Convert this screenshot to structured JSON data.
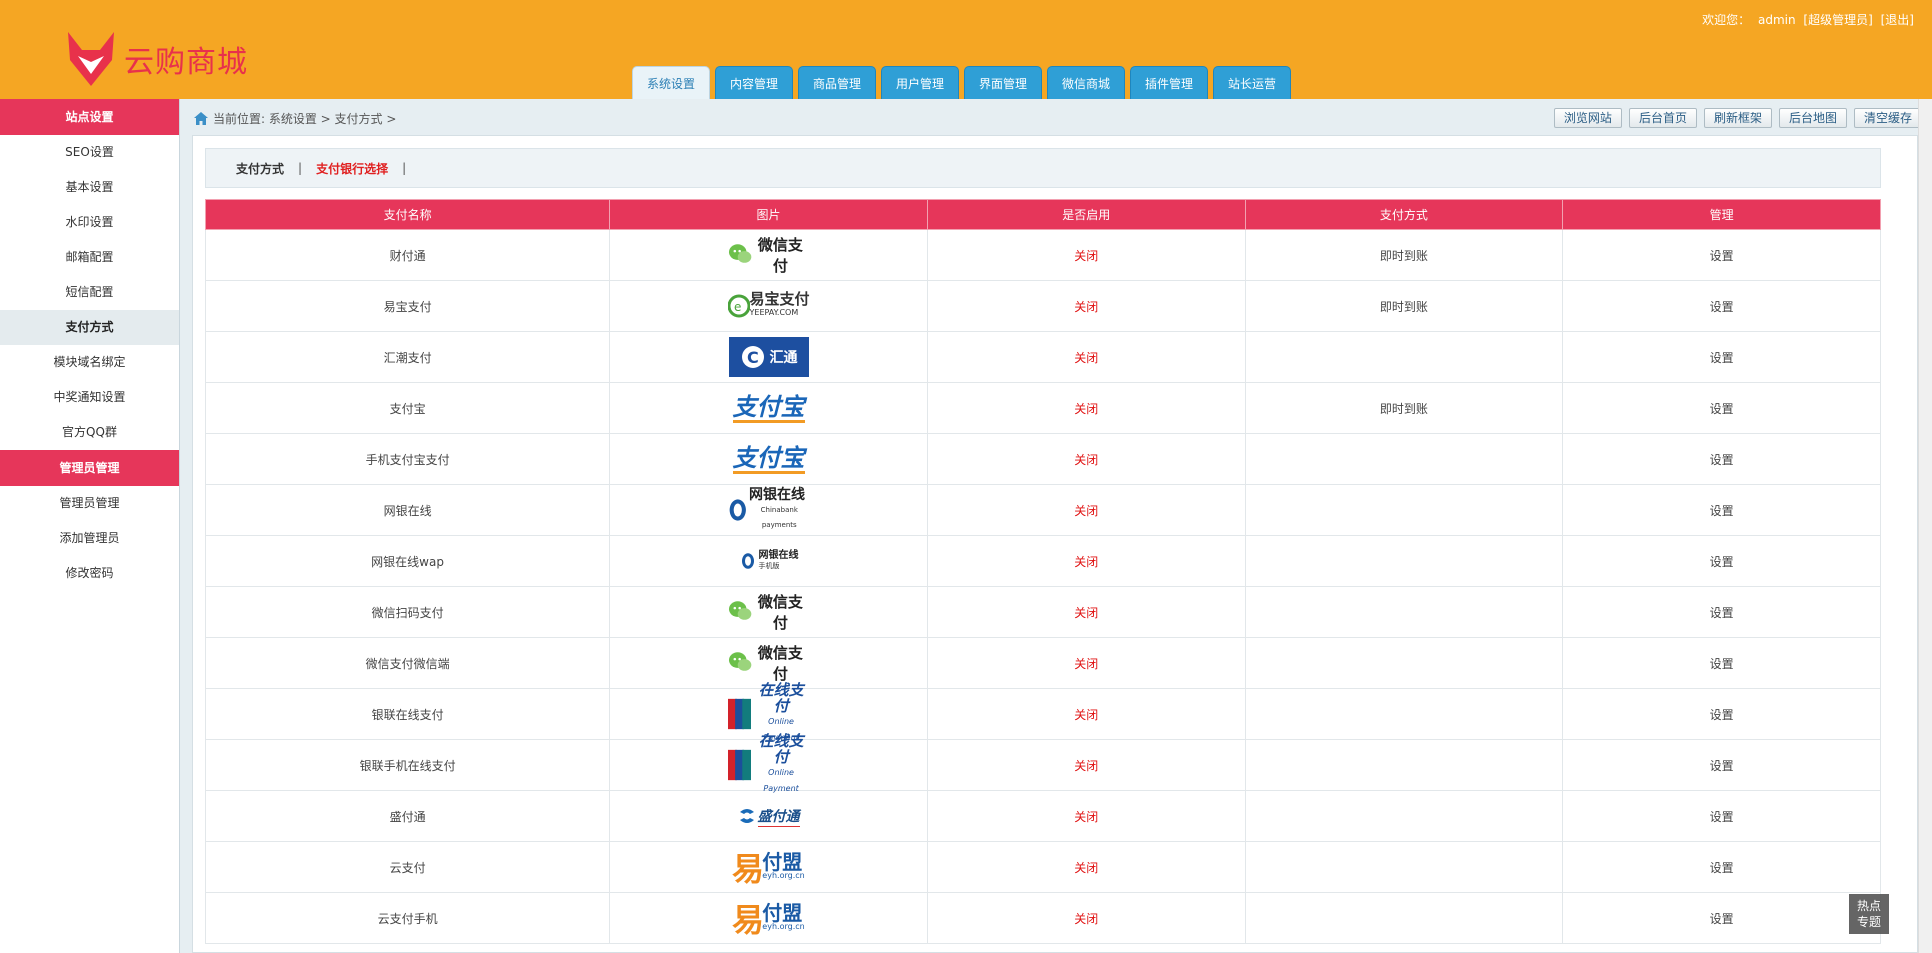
{
  "header": {
    "brand": "云购商城",
    "welcome_label": "欢迎您：",
    "user": "admin",
    "role": "[超级管理员]",
    "logout": "[退出]"
  },
  "nav": {
    "tabs": [
      "系统设置",
      "内容管理",
      "商品管理",
      "用户管理",
      "界面管理",
      "微信商城",
      "插件管理",
      "站长运营"
    ],
    "active": "系统设置"
  },
  "sidebar": {
    "section1": "站点设置",
    "items1": [
      "SEO设置",
      "基本设置",
      "水印设置",
      "邮箱配置",
      "短信配置",
      "支付方式",
      "模块域名绑定",
      "中奖通知设置",
      "官方QQ群"
    ],
    "active": "支付方式",
    "section2": "管理员管理",
    "items2": [
      "管理员管理",
      "添加管理员",
      "修改密码"
    ]
  },
  "breadcrumb": {
    "text": "当前位置: 系统设置 > 支付方式 >"
  },
  "top_buttons": [
    "浏览网站",
    "后台首页",
    "刷新框架",
    "后台地图",
    "清空缓存"
  ],
  "subtabs": {
    "tab1": "支付方式",
    "tab2": "支付银行选择",
    "sep": "|"
  },
  "table": {
    "headers": [
      "支付名称",
      "图片",
      "是否启用",
      "支付方式",
      "管理"
    ],
    "rows": [
      {
        "name": "财付通",
        "logo": "微信支付",
        "logo_type": "wechat",
        "enabled": "关闭",
        "method": "即时到账",
        "manage": "设置"
      },
      {
        "name": "易宝支付",
        "logo": "易宝支付",
        "logo_sub": "YEEPAY.COM",
        "logo_type": "yeepay",
        "enabled": "关闭",
        "method": "即时到账",
        "manage": "设置"
      },
      {
        "name": "汇潮支付",
        "logo": "汇通",
        "logo_type": "ecpss",
        "enabled": "关闭",
        "method": "",
        "manage": "设置"
      },
      {
        "name": "支付宝",
        "logo": "支付宝",
        "logo_type": "alipay",
        "enabled": "关闭",
        "method": "即时到账",
        "manage": "设置"
      },
      {
        "name": "手机支付宝支付",
        "logo": "支付宝",
        "logo_type": "alipay",
        "enabled": "关闭",
        "method": "",
        "manage": "设置"
      },
      {
        "name": "网银在线",
        "logo": "网银在线",
        "logo_sub": "Chinabank payments",
        "logo_type": "chinabank",
        "enabled": "关闭",
        "method": "",
        "manage": "设置"
      },
      {
        "name": "网银在线wap",
        "logo": "网银在线",
        "logo_sub": "手机版",
        "logo_type": "chinabank-small",
        "enabled": "关闭",
        "method": "",
        "manage": "设置"
      },
      {
        "name": "微信扫码支付",
        "logo": "微信支付",
        "logo_type": "wechat",
        "enabled": "关闭",
        "method": "",
        "manage": "设置"
      },
      {
        "name": "微信支付微信端",
        "logo": "微信支付",
        "logo_type": "wechat",
        "enabled": "关闭",
        "method": "",
        "manage": "设置"
      },
      {
        "name": "银联在线支付",
        "logo": "在线支付",
        "logo_sub": "Online Payment",
        "logo_type": "unionpay",
        "enabled": "关闭",
        "method": "",
        "manage": "设置"
      },
      {
        "name": "银联手机在线支付",
        "logo": "在线支付",
        "logo_sub": "Online Payment",
        "logo_type": "unionpay",
        "enabled": "关闭",
        "method": "",
        "manage": "设置"
      },
      {
        "name": "盛付通",
        "logo": "盛付通",
        "logo_type": "shengpay",
        "enabled": "关闭",
        "method": "",
        "manage": "设置"
      },
      {
        "name": "云支付",
        "logo": "付盟",
        "logo_sub": "eyh.org.cn",
        "logo_type": "fumeng",
        "enabled": "关闭",
        "method": "",
        "manage": "设置"
      },
      {
        "name": "云支付手机",
        "logo": "付盟",
        "logo_sub": "eyh.org.cn",
        "logo_type": "fumeng",
        "enabled": "关闭",
        "method": "",
        "manage": "设置"
      }
    ]
  },
  "hot_badge": {
    "line1": "热点",
    "line2": "专题"
  },
  "colors": {
    "header": "#f5a623",
    "accent": "#e6365a",
    "tab": "#2f9fd6",
    "off": "#e01010"
  }
}
